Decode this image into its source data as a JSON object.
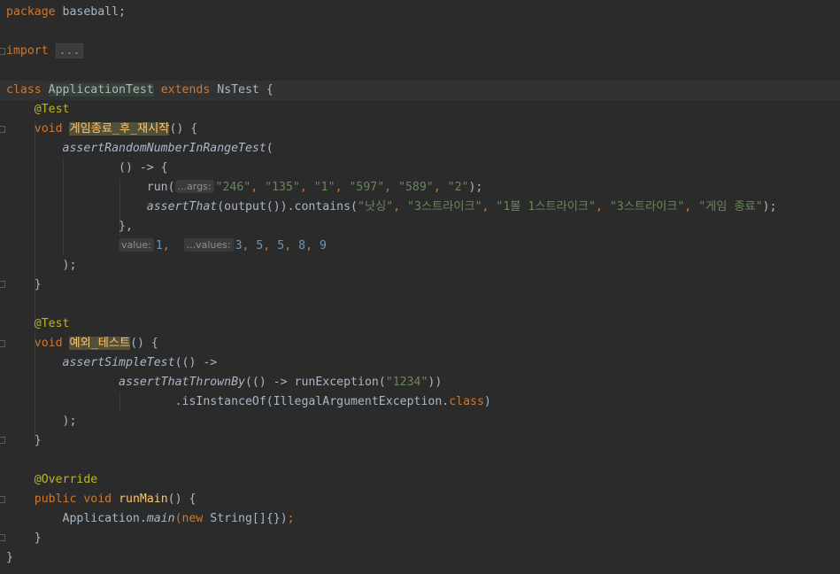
{
  "code": {
    "l1": {
      "kw": "package",
      "rest": " baseball;"
    },
    "l3": {
      "kw": "import",
      "fold": "..."
    },
    "l5": {
      "kw1": "class",
      "cls": "ApplicationTest",
      "kw2": "extends",
      "base": "NsTest",
      "brace": " {"
    },
    "l6": {
      "ann": "@Test"
    },
    "l7": {
      "kw": "void",
      "method": "게임종료_후_재시작",
      "rest": "() {"
    },
    "l8": {
      "call": "assertRandomNumberInRangeTest",
      "rest": "("
    },
    "l9": {
      "text": "() -> {"
    },
    "l10": {
      "fn": "run(",
      "hint": "...args:",
      "args": [
        "\"246\"",
        "\"135\"",
        "\"1\"",
        "\"597\"",
        "\"589\"",
        "\"2\""
      ],
      "end": ");"
    },
    "l11": {
      "call": "assertThat",
      "mid": "(output()).contains(",
      "args": [
        "\"낫싱\"",
        "\"3스트라이크\"",
        "\"1볼 1스트라이크\"",
        "\"3스트라이크\"",
        "\"게임 종료\""
      ],
      "end": ");"
    },
    "l12": {
      "text": "},"
    },
    "l13": {
      "hint1": "value:",
      "v1": "1",
      "hint2": "...values:",
      "vals": [
        "3",
        "5",
        "5",
        "8",
        "9"
      ]
    },
    "l14": {
      "text": ");"
    },
    "l15": {
      "text": "}"
    },
    "l17": {
      "ann": "@Test"
    },
    "l18": {
      "kw": "void",
      "method": "예외_테스트",
      "rest": "() {"
    },
    "l19": {
      "call": "assertSimpleTest",
      "rest": "(() ->"
    },
    "l20": {
      "call": "assertThatThrownBy",
      "mid": "(() -> runException(",
      "str": "\"1234\"",
      "end": "))"
    },
    "l21": {
      "mid": ".isInstanceOf(IllegalArgumentException.",
      "kw": "class",
      "end": ")"
    },
    "l22": {
      "text": ");"
    },
    "l23": {
      "text": "}"
    },
    "l25": {
      "ann": "@Override"
    },
    "l26": {
      "kw1": "public",
      "kw2": "void",
      "method": "runMain",
      "rest": "() {"
    },
    "l27": {
      "cls": "Application.",
      "call": "main",
      "paren": "(",
      "kw": "new",
      "rest": " String[]{})",
      "semi": ";"
    },
    "l28": {
      "text": "}"
    },
    "l29": {
      "text": "}"
    }
  },
  "colors": {
    "background": "#2b2b2b",
    "keyword": "#cc7832",
    "annotation": "#bbb529",
    "string": "#6a8759",
    "number": "#6897bb",
    "method": "#ffc66d",
    "text": "#a9b7c6"
  }
}
